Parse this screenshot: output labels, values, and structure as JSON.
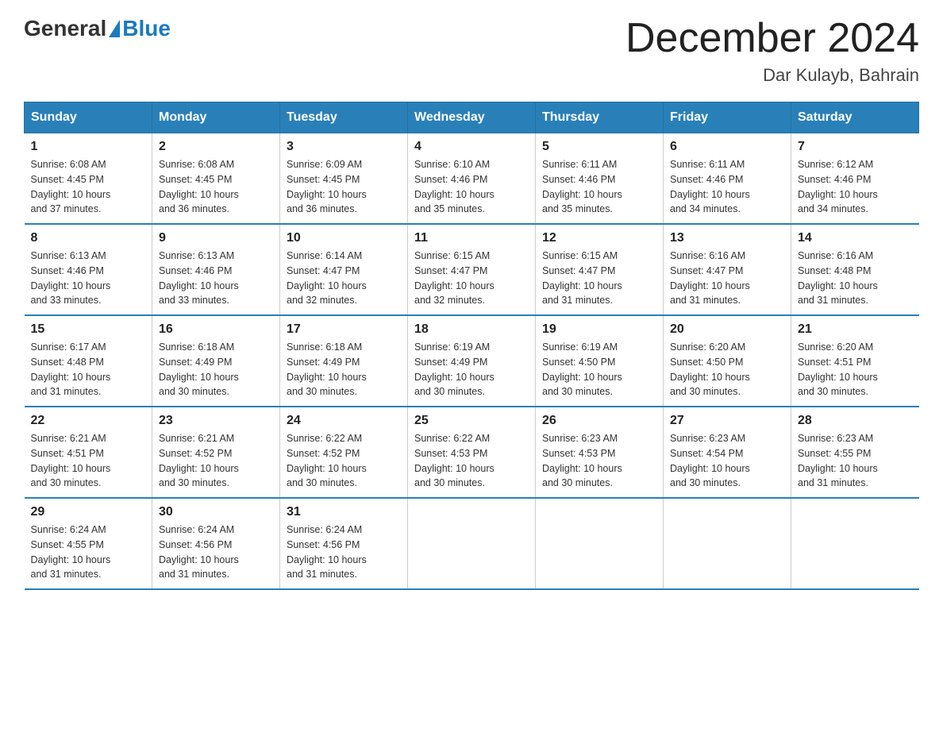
{
  "header": {
    "logo_general": "General",
    "logo_blue": "Blue",
    "month_title": "December 2024",
    "location": "Dar Kulayb, Bahrain"
  },
  "days_of_week": [
    "Sunday",
    "Monday",
    "Tuesday",
    "Wednesday",
    "Thursday",
    "Friday",
    "Saturday"
  ],
  "weeks": [
    [
      {
        "day": "1",
        "sunrise": "6:08 AM",
        "sunset": "4:45 PM",
        "daylight": "10 hours and 37 minutes."
      },
      {
        "day": "2",
        "sunrise": "6:08 AM",
        "sunset": "4:45 PM",
        "daylight": "10 hours and 36 minutes."
      },
      {
        "day": "3",
        "sunrise": "6:09 AM",
        "sunset": "4:45 PM",
        "daylight": "10 hours and 36 minutes."
      },
      {
        "day": "4",
        "sunrise": "6:10 AM",
        "sunset": "4:46 PM",
        "daylight": "10 hours and 35 minutes."
      },
      {
        "day": "5",
        "sunrise": "6:11 AM",
        "sunset": "4:46 PM",
        "daylight": "10 hours and 35 minutes."
      },
      {
        "day": "6",
        "sunrise": "6:11 AM",
        "sunset": "4:46 PM",
        "daylight": "10 hours and 34 minutes."
      },
      {
        "day": "7",
        "sunrise": "6:12 AM",
        "sunset": "4:46 PM",
        "daylight": "10 hours and 34 minutes."
      }
    ],
    [
      {
        "day": "8",
        "sunrise": "6:13 AM",
        "sunset": "4:46 PM",
        "daylight": "10 hours and 33 minutes."
      },
      {
        "day": "9",
        "sunrise": "6:13 AM",
        "sunset": "4:46 PM",
        "daylight": "10 hours and 33 minutes."
      },
      {
        "day": "10",
        "sunrise": "6:14 AM",
        "sunset": "4:47 PM",
        "daylight": "10 hours and 32 minutes."
      },
      {
        "day": "11",
        "sunrise": "6:15 AM",
        "sunset": "4:47 PM",
        "daylight": "10 hours and 32 minutes."
      },
      {
        "day": "12",
        "sunrise": "6:15 AM",
        "sunset": "4:47 PM",
        "daylight": "10 hours and 31 minutes."
      },
      {
        "day": "13",
        "sunrise": "6:16 AM",
        "sunset": "4:47 PM",
        "daylight": "10 hours and 31 minutes."
      },
      {
        "day": "14",
        "sunrise": "6:16 AM",
        "sunset": "4:48 PM",
        "daylight": "10 hours and 31 minutes."
      }
    ],
    [
      {
        "day": "15",
        "sunrise": "6:17 AM",
        "sunset": "4:48 PM",
        "daylight": "10 hours and 31 minutes."
      },
      {
        "day": "16",
        "sunrise": "6:18 AM",
        "sunset": "4:49 PM",
        "daylight": "10 hours and 30 minutes."
      },
      {
        "day": "17",
        "sunrise": "6:18 AM",
        "sunset": "4:49 PM",
        "daylight": "10 hours and 30 minutes."
      },
      {
        "day": "18",
        "sunrise": "6:19 AM",
        "sunset": "4:49 PM",
        "daylight": "10 hours and 30 minutes."
      },
      {
        "day": "19",
        "sunrise": "6:19 AM",
        "sunset": "4:50 PM",
        "daylight": "10 hours and 30 minutes."
      },
      {
        "day": "20",
        "sunrise": "6:20 AM",
        "sunset": "4:50 PM",
        "daylight": "10 hours and 30 minutes."
      },
      {
        "day": "21",
        "sunrise": "6:20 AM",
        "sunset": "4:51 PM",
        "daylight": "10 hours and 30 minutes."
      }
    ],
    [
      {
        "day": "22",
        "sunrise": "6:21 AM",
        "sunset": "4:51 PM",
        "daylight": "10 hours and 30 minutes."
      },
      {
        "day": "23",
        "sunrise": "6:21 AM",
        "sunset": "4:52 PM",
        "daylight": "10 hours and 30 minutes."
      },
      {
        "day": "24",
        "sunrise": "6:22 AM",
        "sunset": "4:52 PM",
        "daylight": "10 hours and 30 minutes."
      },
      {
        "day": "25",
        "sunrise": "6:22 AM",
        "sunset": "4:53 PM",
        "daylight": "10 hours and 30 minutes."
      },
      {
        "day": "26",
        "sunrise": "6:23 AM",
        "sunset": "4:53 PM",
        "daylight": "10 hours and 30 minutes."
      },
      {
        "day": "27",
        "sunrise": "6:23 AM",
        "sunset": "4:54 PM",
        "daylight": "10 hours and 30 minutes."
      },
      {
        "day": "28",
        "sunrise": "6:23 AM",
        "sunset": "4:55 PM",
        "daylight": "10 hours and 31 minutes."
      }
    ],
    [
      {
        "day": "29",
        "sunrise": "6:24 AM",
        "sunset": "4:55 PM",
        "daylight": "10 hours and 31 minutes."
      },
      {
        "day": "30",
        "sunrise": "6:24 AM",
        "sunset": "4:56 PM",
        "daylight": "10 hours and 31 minutes."
      },
      {
        "day": "31",
        "sunrise": "6:24 AM",
        "sunset": "4:56 PM",
        "daylight": "10 hours and 31 minutes."
      },
      null,
      null,
      null,
      null
    ]
  ],
  "labels": {
    "sunrise": "Sunrise:",
    "sunset": "Sunset:",
    "daylight": "Daylight:"
  }
}
